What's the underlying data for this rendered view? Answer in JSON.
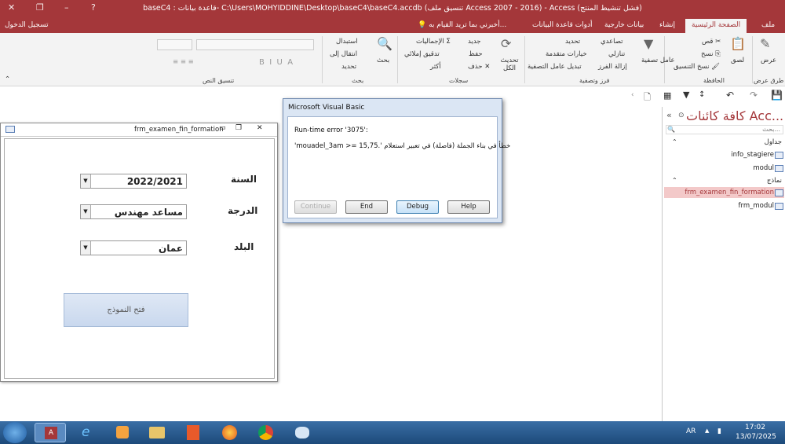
{
  "window": {
    "title": "baseC4 : قاعدة بيانات- C:\\Users\\MOHYIDDINE\\Desktop\\baseC4\\baseC4.accdb (تنسيق ملف Access 2007 - 2016) - Access (فشل تنشيط المنتج)",
    "signin": "تسجيل الدخول"
  },
  "tabs": [
    "ملف",
    "الصفحة الرئيسية",
    "إنشاء",
    "بيانات خارجية",
    "أدوات قاعدة البيانات",
    "أخبرني بما تريد القيام به..."
  ],
  "ribbon": {
    "views": {
      "label": "عرض",
      "group": "طرق عرض"
    },
    "clipboard": {
      "paste": "لصق",
      "cut": "قص",
      "copy": "نسخ",
      "format_painter": "نسخ التنسيق",
      "group": "الحافظة"
    },
    "sort_filter": {
      "filter": "عامل تصفية",
      "ascending": "تصاعدي",
      "descending": "تنازلي",
      "remove_sort": "إزالة الفرز",
      "selection": "تحديد",
      "advanced": "خيارات متقدمة",
      "toggle": "تبديل عامل التصفية",
      "group": "فرز وتصفية"
    },
    "records": {
      "refresh": "تحديث الكل",
      "new": "جديد",
      "save": "حفظ",
      "delete": "حذف",
      "totals": "الإجماليات",
      "spelling": "تدقيق إملائي",
      "more": "أكثر",
      "group": "سجلات"
    },
    "find": {
      "find": "بحث",
      "replace": "استبدال",
      "goto": "انتقال إلى",
      "select": "تحديد",
      "group": "بحث"
    },
    "text_format": {
      "group": "تنسيق النص"
    }
  },
  "nav": {
    "title": "كافة كائنات Acc...",
    "search_placeholder": "بحث...",
    "tables_header": "جداول",
    "tables": [
      "info_stagiere",
      "modul"
    ],
    "forms_header": "نماذج",
    "forms": [
      "frm_examen_fin_formation",
      "frm_modul"
    ]
  },
  "form": {
    "title": "frm_examen_fin_formation",
    "year_label": "السنة",
    "year_value": "2022/2021",
    "grade_label": "الدرجة",
    "grade_value": "مساعد مهندس",
    "city_label": "البلد",
    "city_value": "عمان",
    "open_button": "فتح النموذج"
  },
  "dialog": {
    "title": "Microsoft Visual Basic",
    "error_line": "Run-time error '3075':",
    "message": "'mouadel_3am >= 15,75.' خطأ في بناء الجملة (فاصلة) في تعبير استعلام",
    "buttons": [
      "Continue",
      "End",
      "Debug",
      "Help"
    ]
  },
  "taskbar": {
    "lang": "AR",
    "time": "17:02",
    "date": "13/07/2025"
  },
  "colors": {
    "accent": "#a4373a",
    "taskbar": "#2a5a8f"
  }
}
